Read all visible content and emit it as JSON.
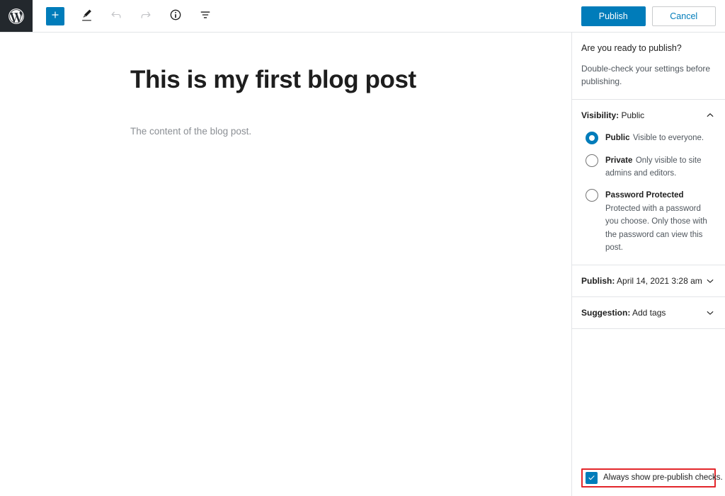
{
  "toolbar": {
    "logo_name": "wordpress-logo",
    "buttons": [
      {
        "name": "add-block-button",
        "icon": "plus-icon",
        "label": "Add block"
      },
      {
        "name": "edit-tool-button",
        "icon": "pencil-icon",
        "label": "Tools"
      },
      {
        "name": "undo-button",
        "icon": "undo-arrow-icon",
        "label": "Undo"
      },
      {
        "name": "redo-button",
        "icon": "redo-arrow-icon",
        "label": "Redo"
      },
      {
        "name": "details-button",
        "icon": "info-circle-icon",
        "label": "Details"
      },
      {
        "name": "list-view-button",
        "icon": "list-view-icon",
        "label": "List view"
      }
    ],
    "publish_label": "Publish",
    "cancel_label": "Cancel"
  },
  "editor": {
    "title": "This is my first blog post",
    "content": "The content of the blog post."
  },
  "sidebar": {
    "intro_heading": "Are you ready to publish?",
    "intro_text": "Double-check your settings before publishing.",
    "visibility": {
      "label": "Visibility:",
      "value": "Public",
      "chevron": "chevron-up-icon",
      "options": [
        {
          "title": "Public",
          "description": "Visible to everyone.",
          "selected": true
        },
        {
          "title": "Private",
          "description": "Only visible to site admins and editors.",
          "selected": false
        },
        {
          "title": "Password Protected",
          "description": "Protected with a password you choose. Only those with the password can view this post.",
          "selected": false
        }
      ]
    },
    "publish_date": {
      "label": "Publish:",
      "value": "April 14, 2021 3:28 am",
      "chevron": "chevron-down-icon"
    },
    "suggestion": {
      "label": "Suggestion:",
      "value": "Add tags",
      "chevron": "chevron-down-icon"
    },
    "footer": {
      "checkbox_label": "Always show pre-publish checks.",
      "checked": true,
      "highlight_color": "#e3262b"
    }
  },
  "colors": {
    "accent_blue": "#007cba",
    "admin_dark": "#23282d",
    "border": "#e2e4e7",
    "text_primary": "#1e1e1e",
    "text_secondary": "#50575e",
    "highlight_red": "#e3262b"
  }
}
